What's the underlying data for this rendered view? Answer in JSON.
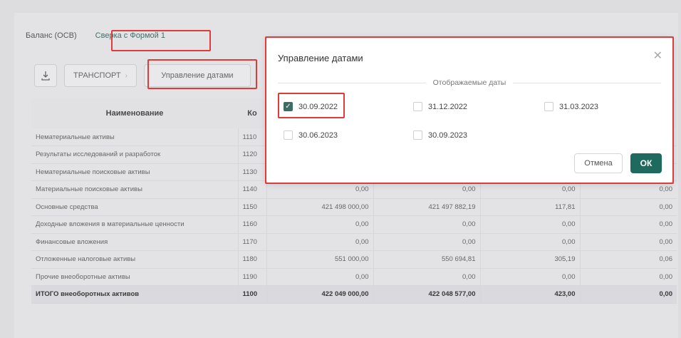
{
  "tabs": [
    "Баланс (ОСВ)",
    "Сверка с Формой 1"
  ],
  "toolbar": {
    "company": "ТРАНСПОРТ",
    "manage_dates": "Управление датами"
  },
  "table": {
    "headers": [
      "Наименование",
      "Ко"
    ],
    "rows": [
      {
        "name": "Нематериальные активы",
        "code": "1110",
        "c1": "",
        "c2": "",
        "c3": "",
        "c4": ""
      },
      {
        "name": "Результаты исследований и разработок",
        "code": "1120",
        "c1": "",
        "c2": "",
        "c3": "",
        "c4": ""
      },
      {
        "name": "Нематериальные поисковые активы",
        "code": "1130",
        "c1": "",
        "c2": "",
        "c3": "",
        "c4": ""
      },
      {
        "name": "Материальные поисковые активы",
        "code": "1140",
        "c1": "0,00",
        "c2": "0,00",
        "c3": "0,00",
        "c4": "0,00"
      },
      {
        "name": "Основные средства",
        "code": "1150",
        "c1": "421 498 000,00",
        "c2": "421 497 882,19",
        "c3": "117,81",
        "c4": "0,00"
      },
      {
        "name": "Доходные вложения в материальные ценности",
        "code": "1160",
        "c1": "0,00",
        "c2": "0,00",
        "c3": "0,00",
        "c4": "0,00"
      },
      {
        "name": "Финансовые вложения",
        "code": "1170",
        "c1": "0,00",
        "c2": "0,00",
        "c3": "0,00",
        "c4": "0,00"
      },
      {
        "name": "Отложенные налоговые активы",
        "code": "1180",
        "c1": "551 000,00",
        "c2": "550 694,81",
        "c3": "305,19",
        "c4": "0,06"
      },
      {
        "name": "Прочие внеоборотные активы",
        "code": "1190",
        "c1": "0,00",
        "c2": "0,00",
        "c3": "0,00",
        "c4": "0,00"
      }
    ],
    "total": {
      "name": "ИТОГО внеоборотных активов",
      "code": "1100",
      "c1": "422 049 000,00",
      "c2": "422 048 577,00",
      "c3": "423,00",
      "c4": "0,00"
    }
  },
  "modal": {
    "title": "Управление датами",
    "section_label": "Отображаемые даты",
    "dates": [
      {
        "label": "30.09.2022",
        "checked": true
      },
      {
        "label": "31.12.2022",
        "checked": false
      },
      {
        "label": "31.03.2023",
        "checked": false
      },
      {
        "label": "30.06.2023",
        "checked": false
      },
      {
        "label": "30.09.2023",
        "checked": false
      }
    ],
    "cancel": "Отмена",
    "ok": "ОК"
  },
  "colors": {
    "accent": "#1f6a5e",
    "highlight": "#e03b3b"
  }
}
